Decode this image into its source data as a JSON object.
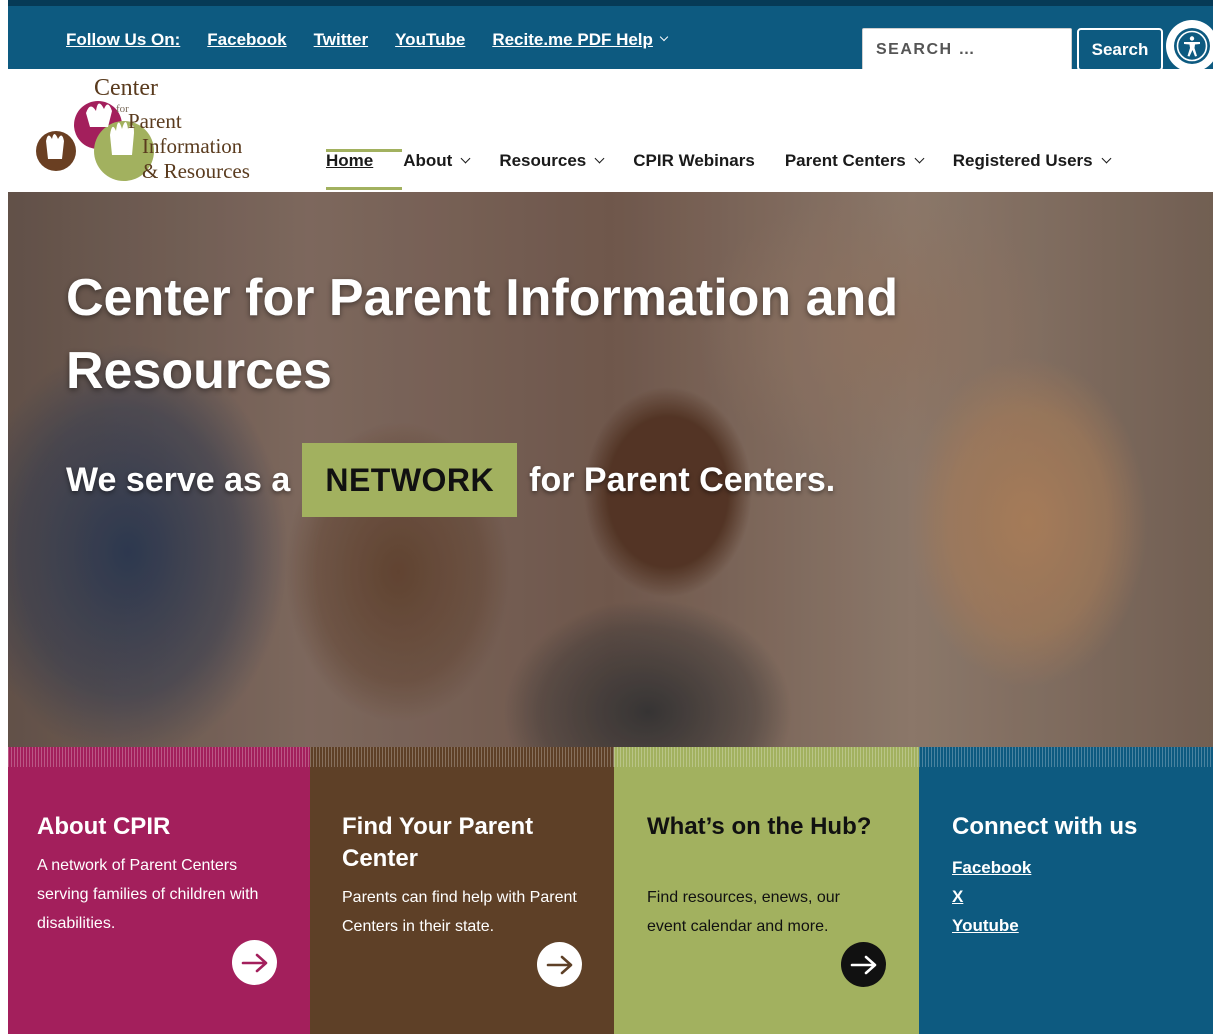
{
  "topbar": {
    "follow_label": "Follow Us On:",
    "social_links": [
      "Facebook",
      "Twitter",
      "YouTube"
    ],
    "recite_label": "Recite.me PDF Help",
    "search_placeholder": "SEARCH …",
    "search_button": "Search",
    "accessibility_icon": "accessibility-icon"
  },
  "logo": {
    "line1": "Center",
    "line2": "for",
    "line3": "Parent",
    "line4": "Information",
    "line5": "& Resources"
  },
  "nav": {
    "items": [
      {
        "label": "Home",
        "has_dropdown": false,
        "active": true
      },
      {
        "label": "About",
        "has_dropdown": true
      },
      {
        "label": "Resources",
        "has_dropdown": true
      },
      {
        "label": "CPIR Webinars",
        "has_dropdown": false
      },
      {
        "label": "Parent Centers",
        "has_dropdown": true
      },
      {
        "label": "Registered Users",
        "has_dropdown": true
      }
    ]
  },
  "hero": {
    "title": "Center for Parent Information and Resources",
    "sub_before": "We serve as a",
    "sub_highlight": "NETWORK",
    "sub_after": "for Parent Centers."
  },
  "cards": [
    {
      "title": "About CPIR",
      "body": "A network of Parent Centers serving families of children with disabilities.",
      "color": "#a31f5c"
    },
    {
      "title": "Find Your Parent Center",
      "body": "Parents can find help with Parent Centers in their state.",
      "color": "#5e4027"
    },
    {
      "title": "What’s on the Hub?",
      "body": "Find resources, enews, our event calendar and more.",
      "color": "#a2b15f"
    },
    {
      "title": "Connect with us",
      "links": [
        "Facebook",
        "X",
        "Youtube"
      ],
      "color": "#0d5a80"
    }
  ],
  "colors": {
    "primary_blue": "#0d5a80",
    "accent_green": "#a2b15f",
    "magenta": "#a31f5c",
    "brown": "#5e4027"
  }
}
